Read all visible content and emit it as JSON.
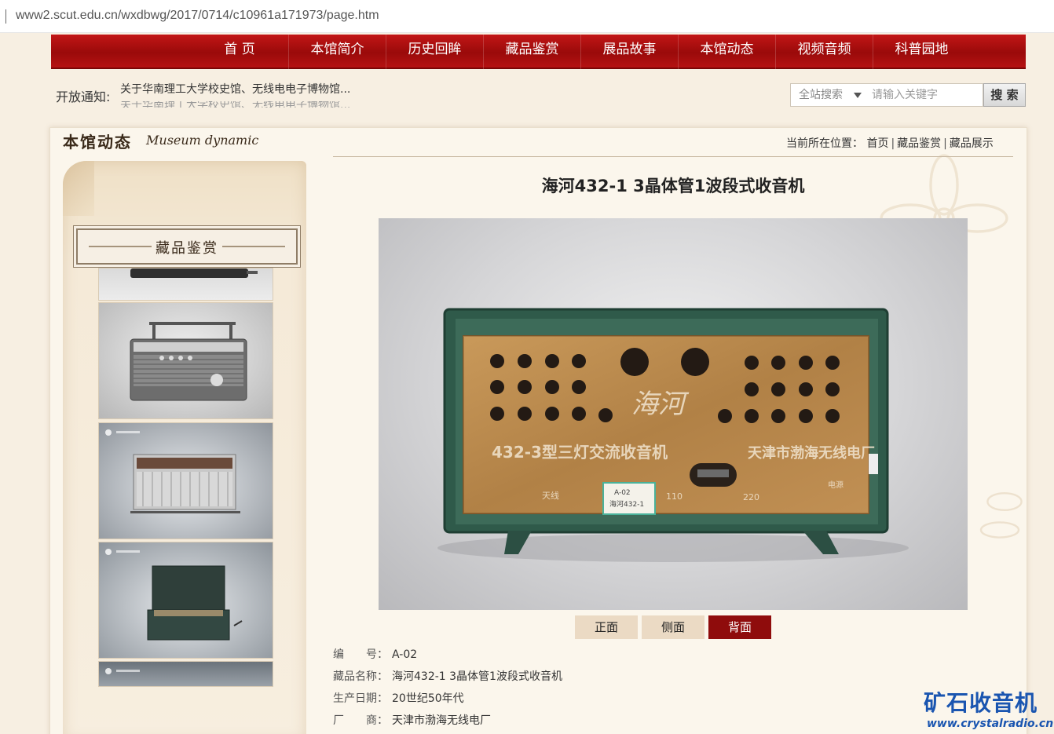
{
  "browser": {
    "url": "www2.scut.edu.cn/wxdbwg/2017/0714/c10961a171973/page.htm"
  },
  "nav": {
    "items": [
      {
        "label": "首 页"
      },
      {
        "label": "本馆简介"
      },
      {
        "label": "历史回眸"
      },
      {
        "label": "藏品鉴赏"
      },
      {
        "label": "展品故事"
      },
      {
        "label": "本馆动态"
      },
      {
        "label": "视频音频"
      },
      {
        "label": "科普园地"
      }
    ]
  },
  "notice": {
    "label": "开放通知:",
    "text": "关于华南理工大学校史馆、无线电电子博物馆..."
  },
  "search": {
    "scope": "全站搜索",
    "placeholder": "请输入关键字",
    "button": "搜 索"
  },
  "section": {
    "title_cn": "本馆动态",
    "title_en": "Museum dynamic"
  },
  "breadcrumb": {
    "prefix": "当前所在位置：",
    "items": [
      "首页",
      "藏品鉴赏",
      "藏品展示"
    ]
  },
  "sidebar": {
    "plaque": "藏品鉴赏",
    "thumbnails": [
      {
        "icon": "radio-thumbnail-icon"
      },
      {
        "icon": "portable-radio-thumbnail-icon"
      },
      {
        "icon": "silver-radio-thumbnail-icon"
      },
      {
        "icon": "phonograph-thumbnail-icon"
      },
      {
        "icon": "partial-thumbnail-icon"
      }
    ]
  },
  "item": {
    "title": "海河432-1 3晶体管1波段式收音机",
    "photo": {
      "logo": "海河",
      "model_text": "432-3型三灯交流收音机",
      "maker_text": "天津市渤海无线电厂",
      "label_1": "A-02",
      "label_2": "海河432-1",
      "antenna": "天线",
      "voltage_1": "110",
      "voltage_2": "220",
      "power": "电源"
    },
    "views": [
      {
        "label": "正面",
        "active": false
      },
      {
        "label": "侧面",
        "active": false
      },
      {
        "label": "背面",
        "active": true
      }
    ],
    "meta": [
      {
        "key": "编　　号：",
        "value": "A-02"
      },
      {
        "key": "藏品名称：",
        "value": "海河432-1 3晶体管1波段式收音机"
      },
      {
        "key": "生产日期：",
        "value": "20世纪50年代"
      },
      {
        "key": "厂　　商：",
        "value": "天津市渤海无线电厂"
      }
    ]
  },
  "watermark": {
    "cn": "矿石收音机",
    "en": "www.crystalradio.cn"
  },
  "colors": {
    "nav_red": "#a80c0c",
    "active_tab": "#8f0c0c",
    "page_bg": "#f7efe2",
    "watermark_blue": "#1a55b0"
  }
}
